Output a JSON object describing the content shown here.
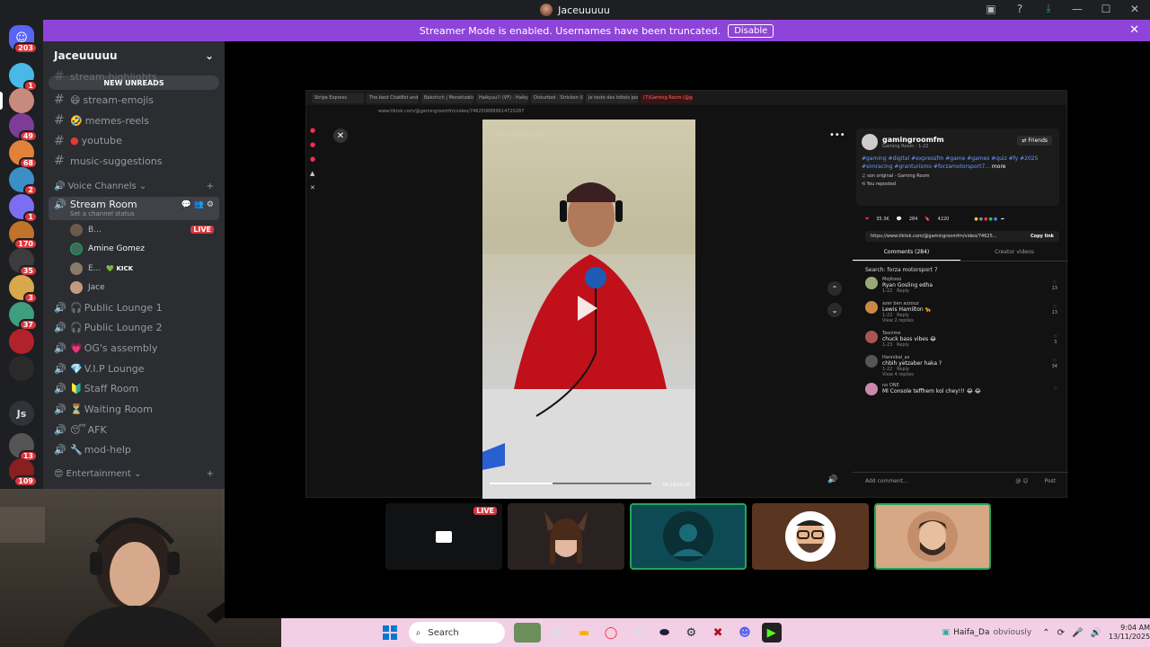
{
  "window": {
    "title": "Jaceuuuuu"
  },
  "banner": {
    "text": "Streamer Mode is enabled. Usernames have been truncated.",
    "button": "Disable"
  },
  "guilds": [
    {
      "badge": "203",
      "color": "#5865f2"
    },
    {
      "badge": "1",
      "color": "#49b8e6"
    },
    {
      "badge": "",
      "color": "#c78b7d"
    },
    {
      "badge": "49",
      "color": "#7d3c98"
    },
    {
      "badge": "68",
      "color": "#e0823c"
    },
    {
      "badge": "2",
      "color": "#3b8fc4"
    },
    {
      "badge": "1",
      "color": "#7b6ef0"
    },
    {
      "badge": "170",
      "color": "#c0732b"
    },
    {
      "badge": "35",
      "color": "#3c3c3c"
    },
    {
      "badge": "3",
      "color": "#d9a84a"
    },
    {
      "badge": "37",
      "color": "#3e9e7e"
    },
    {
      "badge": "",
      "color": "#b0232b"
    },
    {
      "badge": "",
      "color": "#2a2a2a"
    },
    {
      "badge": "",
      "color": "#313338"
    },
    {
      "badge": "13",
      "color": "#555"
    },
    {
      "badge": "109",
      "color": "#8a1f1f"
    }
  ],
  "guild_js_label": "Js",
  "server": {
    "name": "Jaceuuuuu",
    "new_unreads": "NEW UNREADS"
  },
  "channels_top": [
    {
      "name": "stream-highlights"
    },
    {
      "name": "stream-emojis"
    },
    {
      "name": "memes-reels"
    },
    {
      "name": "youtube"
    },
    {
      "name": "music-suggestions"
    }
  ],
  "voice_category": "Voice Channels",
  "stream_room": {
    "name": "Stream Room",
    "status": "Set a channel status"
  },
  "voice_users": [
    {
      "name": "B...",
      "badge": "LIVE"
    },
    {
      "name": "Amine Gomez",
      "badge": ""
    },
    {
      "name": "E...",
      "badge": "KICK"
    },
    {
      "name": "Jace",
      "badge": ""
    }
  ],
  "voice_channels": [
    {
      "name": "Public Lounge 1"
    },
    {
      "name": "Public Lounge 2"
    },
    {
      "name": "OG's assembly"
    },
    {
      "name": "V.I.P Lounge"
    },
    {
      "name": "Staff Room"
    },
    {
      "name": "Waiting Room"
    },
    {
      "name": "AFK"
    },
    {
      "name": "mod-help"
    }
  ],
  "entertainment_category": "Entertainment",
  "browser": {
    "tabs": [
      "Stripe Express",
      "The best ChatBot and W...",
      "Bakchich | Monetization",
      "Haikyuu!! (VF) - Haikyuu",
      "Disturbed - Stricken (OF)",
      "Je teste des hôtels pour",
      "(7)Gaming Room (@gam"
    ],
    "url": "www.tiktok.com/@gamingroomfm/video/7462508889614720287"
  },
  "video": {
    "search_label": "Find related content",
    "time": "00:14/02:15"
  },
  "tiktok": {
    "account": "gamingroomfm",
    "account_sub": "Gaming Room · 1-22",
    "follow": "Friends",
    "hashtags": "#gaming #digital #expressfm #game #games #quiz #fy #2025 #simracing #granturismo #forzamotorsport7...",
    "more": "more",
    "sound": "son original - Gaming Room",
    "reposted": "You reposted",
    "likes": "35.3K",
    "comments_count": "284",
    "saves": "4220",
    "share_url": "https://www.tiktok.com/@gamingroomfm/video/74625...",
    "copy_link": "Copy link",
    "tab_comments": "Comments (284)",
    "tab_creator": "Creator videos",
    "search_hint": "Search: forza motorsport 7",
    "add_comment": "Add comment...",
    "post": "Post",
    "comments": [
      {
        "user": "Mojitooo",
        "text": "Ryan Gosling edha",
        "date": "1-22",
        "reply": "Reply",
        "likes": "13",
        "replies": ""
      },
      {
        "user": "azer ben azzouz",
        "text": "Lewis Hamilton 🐆",
        "date": "1-22",
        "reply": "Reply",
        "likes": "13",
        "replies": "View 2 replies"
      },
      {
        "user": "Tasnime",
        "text": "chuck bass vibes 😂",
        "date": "1-23",
        "reply": "Reply",
        "likes": "3",
        "replies": ""
      },
      {
        "user": "Hannibal_az",
        "text": "chbih yetzaber haka ?",
        "date": "1-22",
        "reply": "Reply",
        "likes": "34",
        "replies": "View 4 replies"
      },
      {
        "user": "no ONE",
        "text": "Ml Console teffhem kol chey!!! 😂 😂",
        "date": "",
        "reply": "",
        "likes": "",
        "replies": ""
      }
    ]
  },
  "tiles": [
    {
      "live": "LIVE"
    },
    {
      "live": ""
    },
    {
      "live": ""
    },
    {
      "live": ""
    },
    {
      "live": ""
    }
  ],
  "taskbar": {
    "search": "Search",
    "user": "Haifa_Da",
    "user_status": "obviously",
    "time": "9:04 AM",
    "date": "13/11/2025"
  }
}
